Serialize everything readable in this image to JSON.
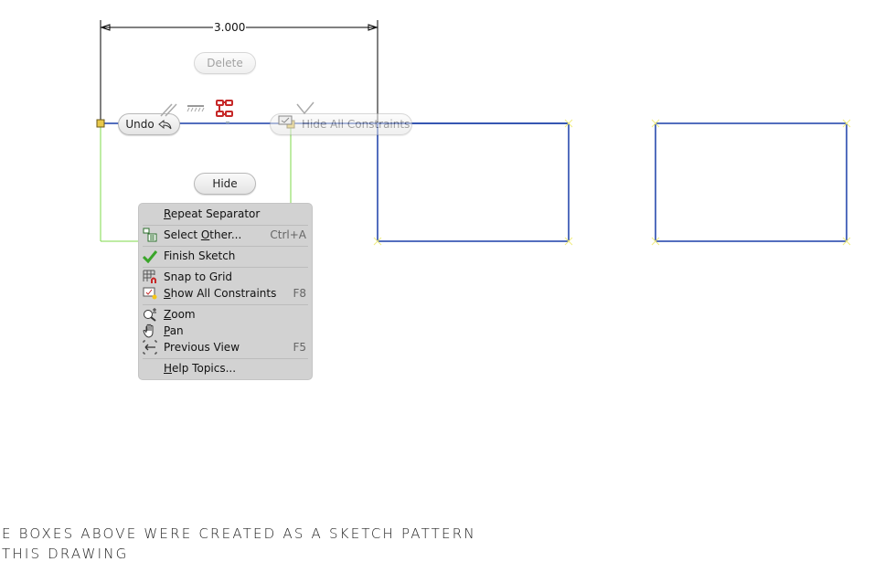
{
  "sketch": {
    "dimension_value": "3.000",
    "colors": {
      "sketch_line": "#1a3ea8",
      "constraint_line": "#7ed84a",
      "dimension_line": "#000000",
      "endpoint_marker": "#e8c84a",
      "coincident_icon": "#c62828"
    }
  },
  "marking_menu": {
    "delete_label": "Delete",
    "undo_label": "Undo",
    "hide_all_constraints_label": "Hide All Constraints",
    "hide_label": "Hide"
  },
  "context_menu": {
    "items": [
      {
        "label_pre": "",
        "mnemonic": "R",
        "label_post": "epeat Separator",
        "shortcut": "",
        "icon": "none"
      },
      {
        "label_pre": "Select ",
        "mnemonic": "O",
        "label_post": "ther...",
        "shortcut": "Ctrl+A",
        "icon": "select-other-icon"
      },
      {
        "label_pre": "Finish Sketch",
        "mnemonic": "",
        "label_post": "",
        "shortcut": "",
        "icon": "checkmark-icon"
      },
      {
        "label_pre": "Snap to Grid",
        "mnemonic": "",
        "label_post": "",
        "shortcut": "",
        "icon": "snap-grid-icon"
      },
      {
        "label_pre": "",
        "mnemonic": "S",
        "label_post": "how All Constraints",
        "shortcut": "F8",
        "icon": "show-constraints-icon"
      },
      {
        "label_pre": "",
        "mnemonic": "Z",
        "label_post": "oom",
        "shortcut": "",
        "icon": "zoom-icon"
      },
      {
        "label_pre": "",
        "mnemonic": "P",
        "label_post": "an",
        "shortcut": "",
        "icon": "pan-hand-icon"
      },
      {
        "label_pre": "Previous View",
        "mnemonic": "",
        "label_post": "",
        "shortcut": "F5",
        "icon": "previous-view-icon"
      },
      {
        "label_pre": "",
        "mnemonic": "H",
        "label_post": "elp Topics...",
        "shortcut": "",
        "icon": "none"
      }
    ]
  },
  "drawing_note": {
    "line1": "E BOXES ABOVE WERE CREATED AS A SKETCH PATTERN",
    "line2": "THIS DRAWING"
  }
}
